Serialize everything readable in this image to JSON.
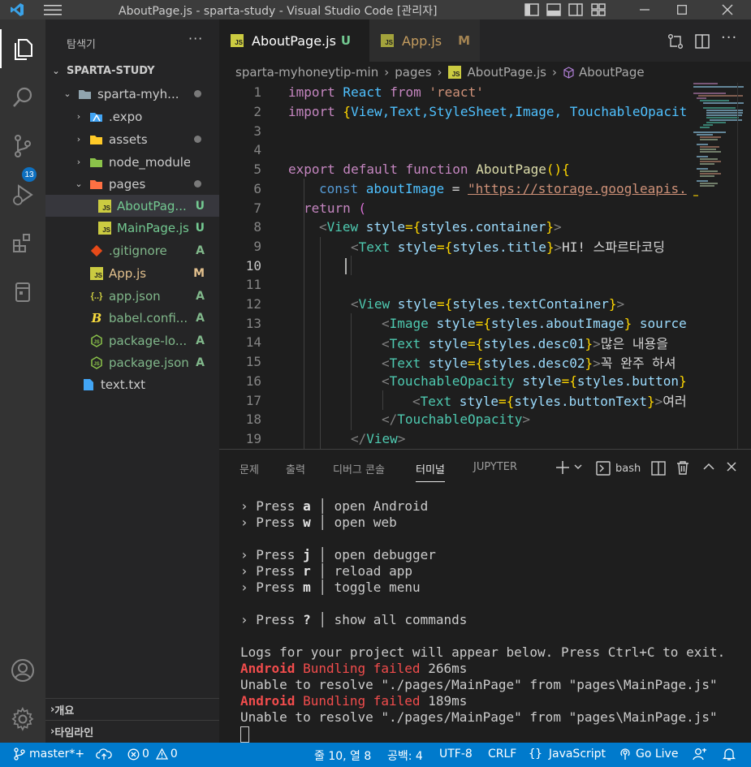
{
  "window": {
    "title": "AboutPage.js - sparta-study - Visual Studio Code [관리자]"
  },
  "activity_bar": {
    "scm_badge": "13"
  },
  "sidebar": {
    "header": "탐색기",
    "more": "···",
    "root": "SPARTA-STUDY",
    "items": [
      {
        "label": "sparta-myh...",
        "status": ""
      },
      {
        "label": ".expo",
        "status": ""
      },
      {
        "label": "assets",
        "status": ""
      },
      {
        "label": "node_modules",
        "status": ""
      },
      {
        "label": "pages",
        "status": ""
      },
      {
        "label": "AboutPag...",
        "status": "U"
      },
      {
        "label": "MainPage.js",
        "status": "U"
      },
      {
        "label": ".gitignore",
        "status": "A"
      },
      {
        "label": "App.js",
        "status": "M"
      },
      {
        "label": "app.json",
        "status": "A"
      },
      {
        "label": "babel.confi...",
        "status": "A"
      },
      {
        "label": "package-lo...",
        "status": "A"
      },
      {
        "label": "package.json",
        "status": "A"
      },
      {
        "label": "text.txt",
        "status": ""
      }
    ],
    "outline": "개요",
    "timeline": "타임라인"
  },
  "tabs": [
    {
      "label": "AboutPage.js",
      "status": "U"
    },
    {
      "label": "App.js",
      "status": "M"
    }
  ],
  "breadcrumb": {
    "folder": "sparta-myhoneytip-min",
    "sub": "pages",
    "file": "AboutPage.js",
    "symbol": "AboutPage"
  },
  "code": {
    "line_numbers": [
      "1",
      "2",
      "3",
      "4",
      "5",
      "6",
      "7",
      "8",
      "9",
      "10",
      "11",
      "12",
      "13",
      "14",
      "15",
      "16",
      "17",
      "18",
      "19"
    ],
    "l1": {
      "a": "import",
      "b": " React ",
      "c": "from",
      "d": " 'react'"
    },
    "l2": {
      "a": "import",
      "b": " {",
      "c": "View,Text,StyleSheet,Image, TouchableOpacit"
    },
    "l5": {
      "a": "export default function ",
      "b": "AboutPage",
      "c": "(){"
    },
    "l6": {
      "a": "const ",
      "b": "aboutImage",
      "c": " = ",
      "d": "\"https://storage.googleapis."
    },
    "l7": {
      "a": "return",
      "b": " ("
    },
    "l8": {
      "a": "<",
      "b": "View",
      "c": " style",
      "d": "={",
      "e": "styles",
      "f": ".container",
      "g": "}",
      "h": ">"
    },
    "l9": {
      "a": "<",
      "b": "Text",
      "c": " style",
      "d": "={",
      "e": "styles",
      "f": ".title",
      "g": "}",
      "h": ">",
      "i": "HI! 스파르타코딩"
    },
    "l12": {
      "a": "<",
      "b": "View",
      "c": " style",
      "d": "={",
      "e": "styles",
      "f": ".textContainer",
      "g": "}",
      "h": ">"
    },
    "l13": {
      "a": "<",
      "b": "Image",
      "c": " style",
      "d": "={",
      "e": "styles",
      "f": ".aboutImage",
      "g": "}",
      "i": " source"
    },
    "l14": {
      "a": "<",
      "b": "Text",
      "c": " style",
      "d": "={",
      "e": "styles",
      "f": ".desc01",
      "g": "}",
      "h": ">",
      "i": "많은 내용을"
    },
    "l15": {
      "a": "<",
      "b": "Text",
      "c": " style",
      "d": "={",
      "e": "styles",
      "f": ".desc02",
      "g": "}",
      "h": ">",
      "i": "꼭 완주 하셔"
    },
    "l16": {
      "a": "<",
      "b": "TouchableOpacity",
      "c": " style",
      "d": "={",
      "e": "styles",
      "f": ".button",
      "g": "}"
    },
    "l17": {
      "a": "<",
      "b": "Text",
      "c": " style",
      "d": "={",
      "e": "styles",
      "f": ".buttonText",
      "g": "}",
      "h": ">",
      "i": "여러"
    },
    "l18": {
      "a": "</",
      "b": "TouchableOpacity",
      "h": ">"
    },
    "l19": {
      "a": "</",
      "b": "View",
      "h": ">"
    }
  },
  "panel": {
    "tabs": [
      "문제",
      "출력",
      "디버그 콘솔",
      "터미널",
      "JUPYTER"
    ],
    "shell": "bash"
  },
  "terminal": {
    "press": "› Press",
    "bar": "│",
    "keys": [
      {
        "key": "a",
        "desc": "open Android"
      },
      {
        "key": "w",
        "desc": "open web"
      },
      {
        "key": "j",
        "desc": "open debugger"
      },
      {
        "key": "r",
        "desc": "reload app"
      },
      {
        "key": "m",
        "desc": "toggle menu"
      },
      {
        "key": "?",
        "desc": "show all commands"
      }
    ],
    "logs_line": "Logs for your project will appear below. Press Ctrl+C to exit.",
    "android": "Android",
    "bundling_failed": " Bundling failed",
    "time1": " 266ms",
    "time2": " 189ms",
    "error": "Unable to resolve \"./pages/MainPage\" from \"pages\\MainPage.js\""
  },
  "status_bar": {
    "branch": "master*+",
    "errors": "0",
    "warnings": "0",
    "position": "줄 10, 열 8",
    "spaces": "공백: 4",
    "encoding": "UTF-8",
    "eol": "CRLF",
    "language": "JavaScript",
    "golive": "Go Live"
  },
  "colors": {
    "accent": "#007acc",
    "js_icon": "#cbcb41",
    "untracked": "#73c991",
    "added": "#81b88b",
    "modified": "#e2c08d",
    "error": "#f14c4c"
  }
}
